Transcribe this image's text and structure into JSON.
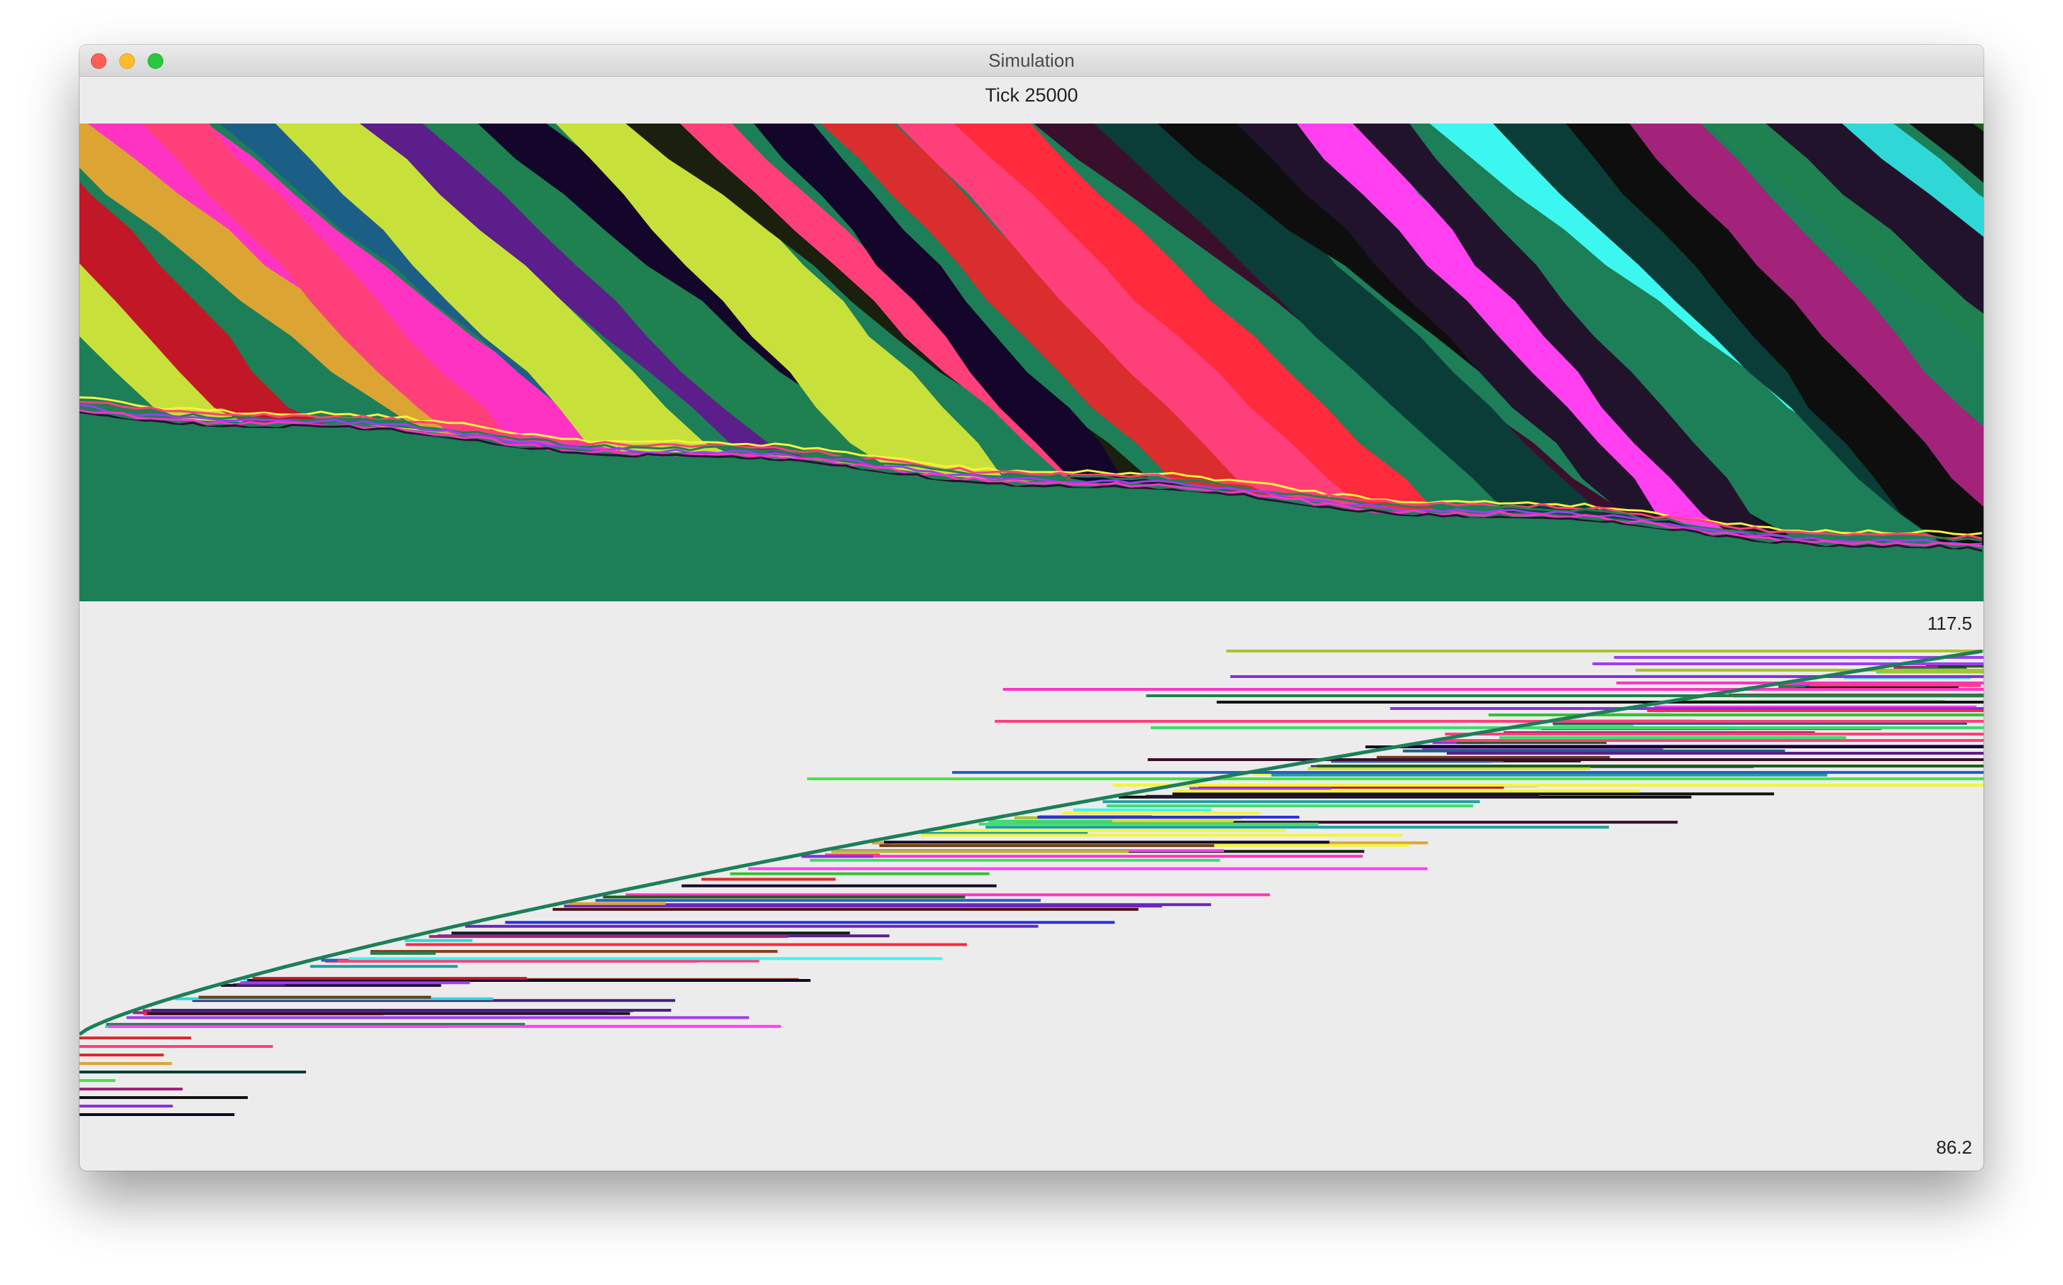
{
  "window": {
    "title": "Simulation",
    "status": "Tick 25000"
  },
  "graph": {
    "y_max_label": "117.5",
    "y_min_label": "86.2"
  },
  "colors": {
    "window_bg": "#ececec",
    "base_green": "#1c7f58",
    "palette": [
      "#0b3d38",
      "#3a0f2c",
      "#1a1f0e",
      "#14062a",
      "#ff2a3c",
      "#f4f43e",
      "#3cf7ef",
      "#ff3ff0",
      "#c8e03a",
      "#2fd8d6",
      "#2a30e0",
      "#c21727",
      "#34c22e",
      "#8a2fe0",
      "#6a25bd",
      "#a3237a",
      "#1c5f86",
      "#46237e",
      "#520f14",
      "#22132d",
      "#0c2014",
      "#ff3f7a",
      "#47e63f",
      "#9a3ff0",
      "#dba433",
      "#abc12e",
      "#1f9fa0",
      "#8a3b1a",
      "#1d5e17",
      "#5b1e8a",
      "#2560c9",
      "#121212",
      "#1f8050",
      "#da2d2d",
      "#ff33c2",
      "#0e0e0e",
      "#3ddc6d",
      "#6b3d1a"
    ]
  }
}
